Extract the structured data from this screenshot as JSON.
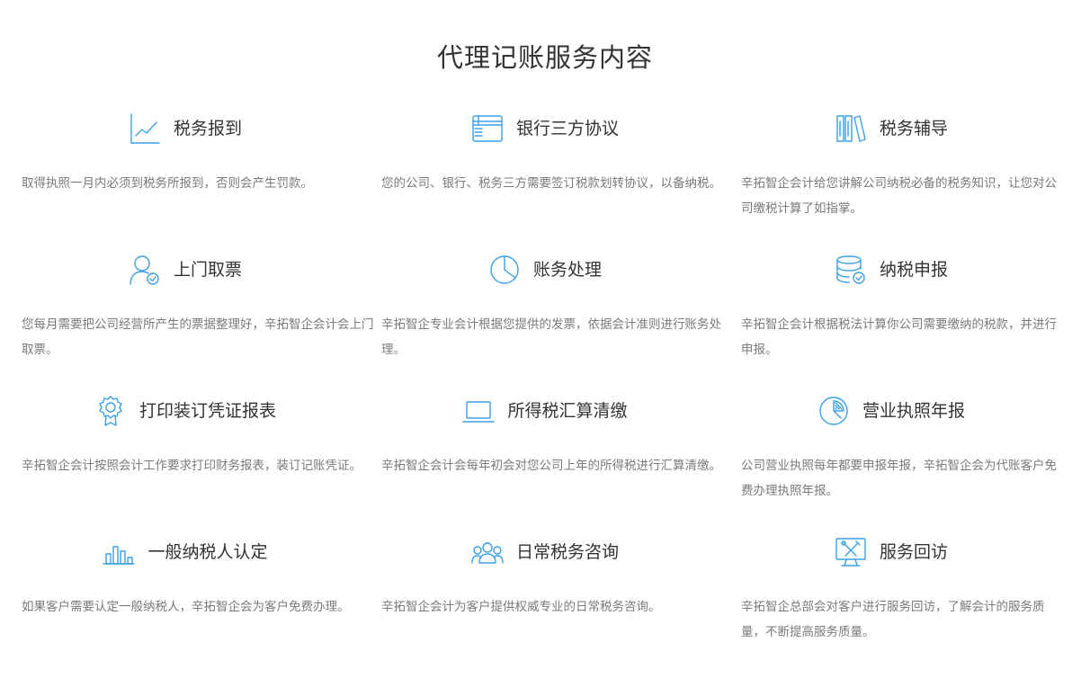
{
  "page": {
    "title": "代理记账服务内容"
  },
  "services": [
    {
      "icon": "line-chart-icon",
      "title": "税务报到",
      "desc": "取得执照一月内必须到税务所报到，否则会产生罚款。"
    },
    {
      "icon": "browser-window-icon",
      "title": "银行三方协议",
      "desc": "您的公司、银行、税务三方需要签订税款划转协议，以备纳税。"
    },
    {
      "icon": "books-icon",
      "title": "税务辅导",
      "desc": "辛拓智企会计给您讲解公司纳税必备的税务知识，让您对公司缴税计算了如指掌。"
    },
    {
      "icon": "user-check-icon",
      "title": "上门取票",
      "desc": "您每月需要把公司经营所产生的票据整理好，辛拓智企会计会上门取票。"
    },
    {
      "icon": "pie-chart-icon",
      "title": "账务处理",
      "desc": "辛拓智企专业会计根据您提供的发票，依据会计准则进行账务处理。"
    },
    {
      "icon": "database-check-icon",
      "title": "纳税申报",
      "desc": "辛拓智企会计根据税法计算你公司需要缴纳的税款，并进行申报。"
    },
    {
      "icon": "award-badge-icon",
      "title": "打印装订凭证报表",
      "desc": "辛拓智企会计按照会计工作要求打印财务报表，装订记账凭证。"
    },
    {
      "icon": "laptop-icon",
      "title": "所得税汇算清缴",
      "desc": "辛拓智企会计会每年初会对您公司上年的所得税进行汇算清缴。"
    },
    {
      "icon": "pie-slice-icon",
      "title": "营业执照年报",
      "desc": "公司营业执照每年都要申报年报，辛拓智企会为代账客户免费办理执照年报。"
    },
    {
      "icon": "bar-chart-icon",
      "title": "一般纳税人认定",
      "desc": "如果客户需要认定一般纳税人，辛拓智企会为客户免费办理。"
    },
    {
      "icon": "group-users-icon",
      "title": "日常税务咨询",
      "desc": "辛拓智企会计为客户提供权威专业的日常税务咨询。"
    },
    {
      "icon": "monitor-tools-icon",
      "title": "服务回访",
      "desc": "辛拓智企总部会对客户进行服务回访，了解会计的服务质量，不断提高服务质量。"
    }
  ],
  "colors": {
    "accent": "#3ba0e6",
    "title": "#333333",
    "desc": "#7a7a7a"
  }
}
